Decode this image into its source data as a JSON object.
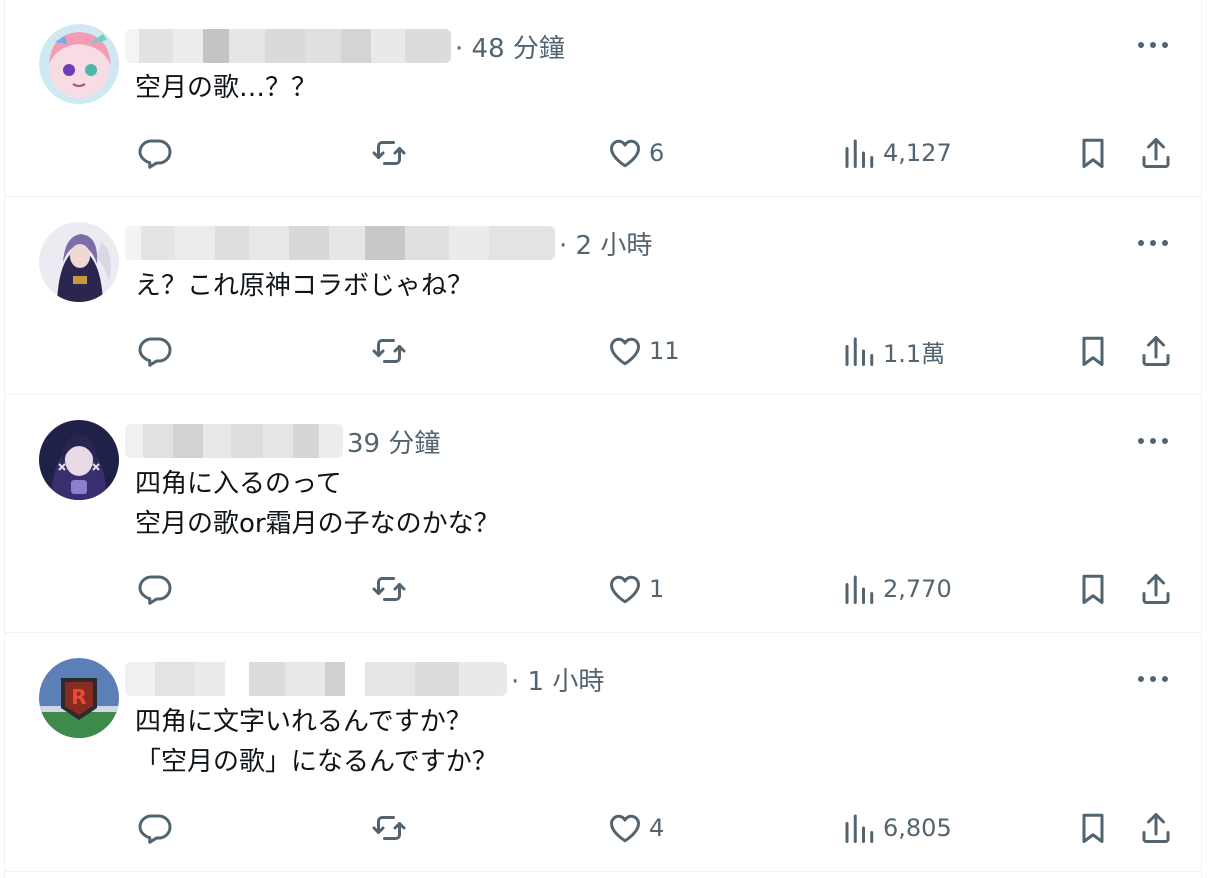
{
  "icons": {
    "reply": "speech-bubble-icon",
    "repost": "repost-arrows-icon",
    "like": "heart-outline-icon",
    "views": "bar-chart-icon",
    "bookmark": "bookmark-icon",
    "share": "upload-share-icon",
    "more": "ellipsis-icon"
  },
  "colors": {
    "text": "#0f1419",
    "secondary": "#536471",
    "divider": "#eff3f4"
  },
  "posts": [
    {
      "timestamp": "· 48 分鐘",
      "text": "空月の歌…？？",
      "likes": "6",
      "views": "4,127"
    },
    {
      "timestamp": "· 2 小時",
      "text": "え？これ原神コラボじゃね？",
      "likes": "11",
      "views": "1.1萬"
    },
    {
      "timestamp": "39 分鐘",
      "text": "四角に入るのって\n空月の歌or霜月の子なのかな？",
      "likes": "1",
      "views": "2,770"
    },
    {
      "timestamp": "· 1 小時",
      "text": "四角に文字いれるんですか？\n「空月の歌」になるんですか？",
      "likes": "4",
      "views": "6,805"
    }
  ]
}
